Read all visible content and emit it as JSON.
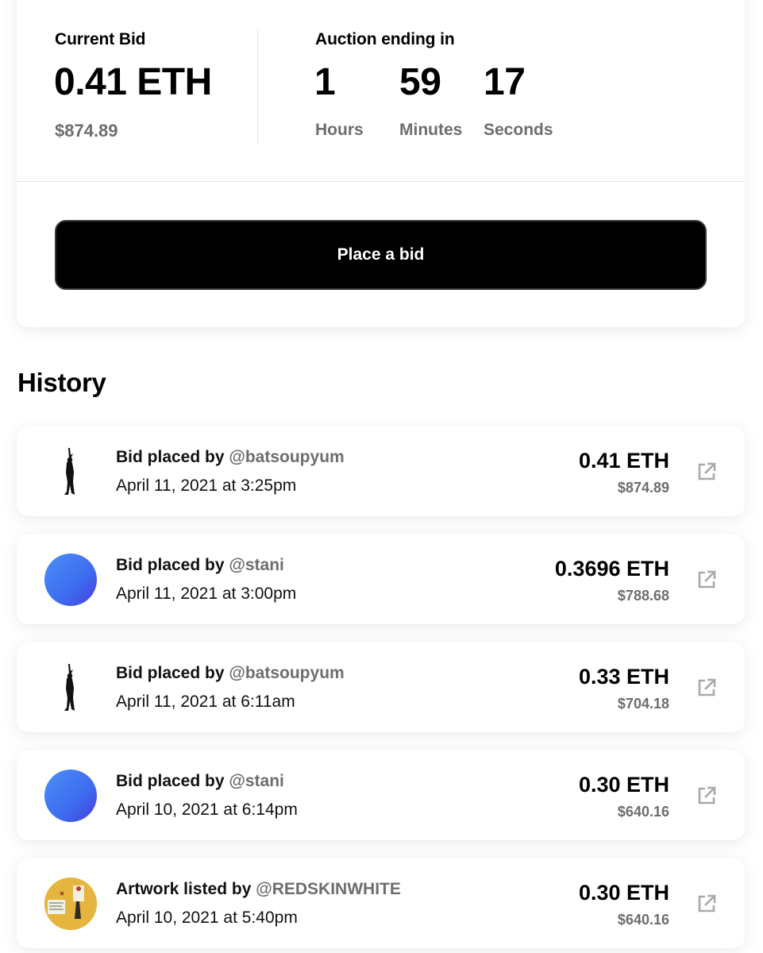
{
  "auction": {
    "current_bid_label": "Current Bid",
    "current_bid_eth": "0.41 ETH",
    "current_bid_usd": "$874.89",
    "ending_label": "Auction ending in",
    "hours": "1",
    "hours_label": "Hours",
    "minutes": "59",
    "minutes_label": "Minutes",
    "seconds": "17",
    "seconds_label": "Seconds",
    "bid_button_label": "Place a bid"
  },
  "history": {
    "title": "History",
    "items": [
      {
        "action": "Bid placed by",
        "user": "@batsoupyum",
        "date": "April 11, 2021 at 3:25pm",
        "eth": "0.41 ETH",
        "usd": "$874.89",
        "avatar": "silhouette"
      },
      {
        "action": "Bid placed by",
        "user": "@stani",
        "date": "April 11, 2021 at 3:00pm",
        "eth": "0.3696 ETH",
        "usd": "$788.68",
        "avatar": "gradient"
      },
      {
        "action": "Bid placed by",
        "user": "@batsoupyum",
        "date": "April 11, 2021 at 6:11am",
        "eth": "0.33 ETH",
        "usd": "$704.18",
        "avatar": "silhouette"
      },
      {
        "action": "Bid placed by",
        "user": "@stani",
        "date": "April 10, 2021 at 6:14pm",
        "eth": "0.30 ETH",
        "usd": "$640.16",
        "avatar": "gradient"
      },
      {
        "action": "Artwork listed by",
        "user": "@REDSKINWHITE",
        "date": "April 10, 2021 at 5:40pm",
        "eth": "0.30 ETH",
        "usd": "$640.16",
        "avatar": "art"
      }
    ]
  },
  "icons": {
    "external_link": "external-link-icon"
  },
  "colors": {
    "button_bg": "#000000",
    "muted_text": "#6d6d6d",
    "avatar_gradient_start": "#4b8ff5",
    "avatar_gradient_end": "#4a3ee0",
    "art_avatar_bg": "#e6b53d"
  }
}
